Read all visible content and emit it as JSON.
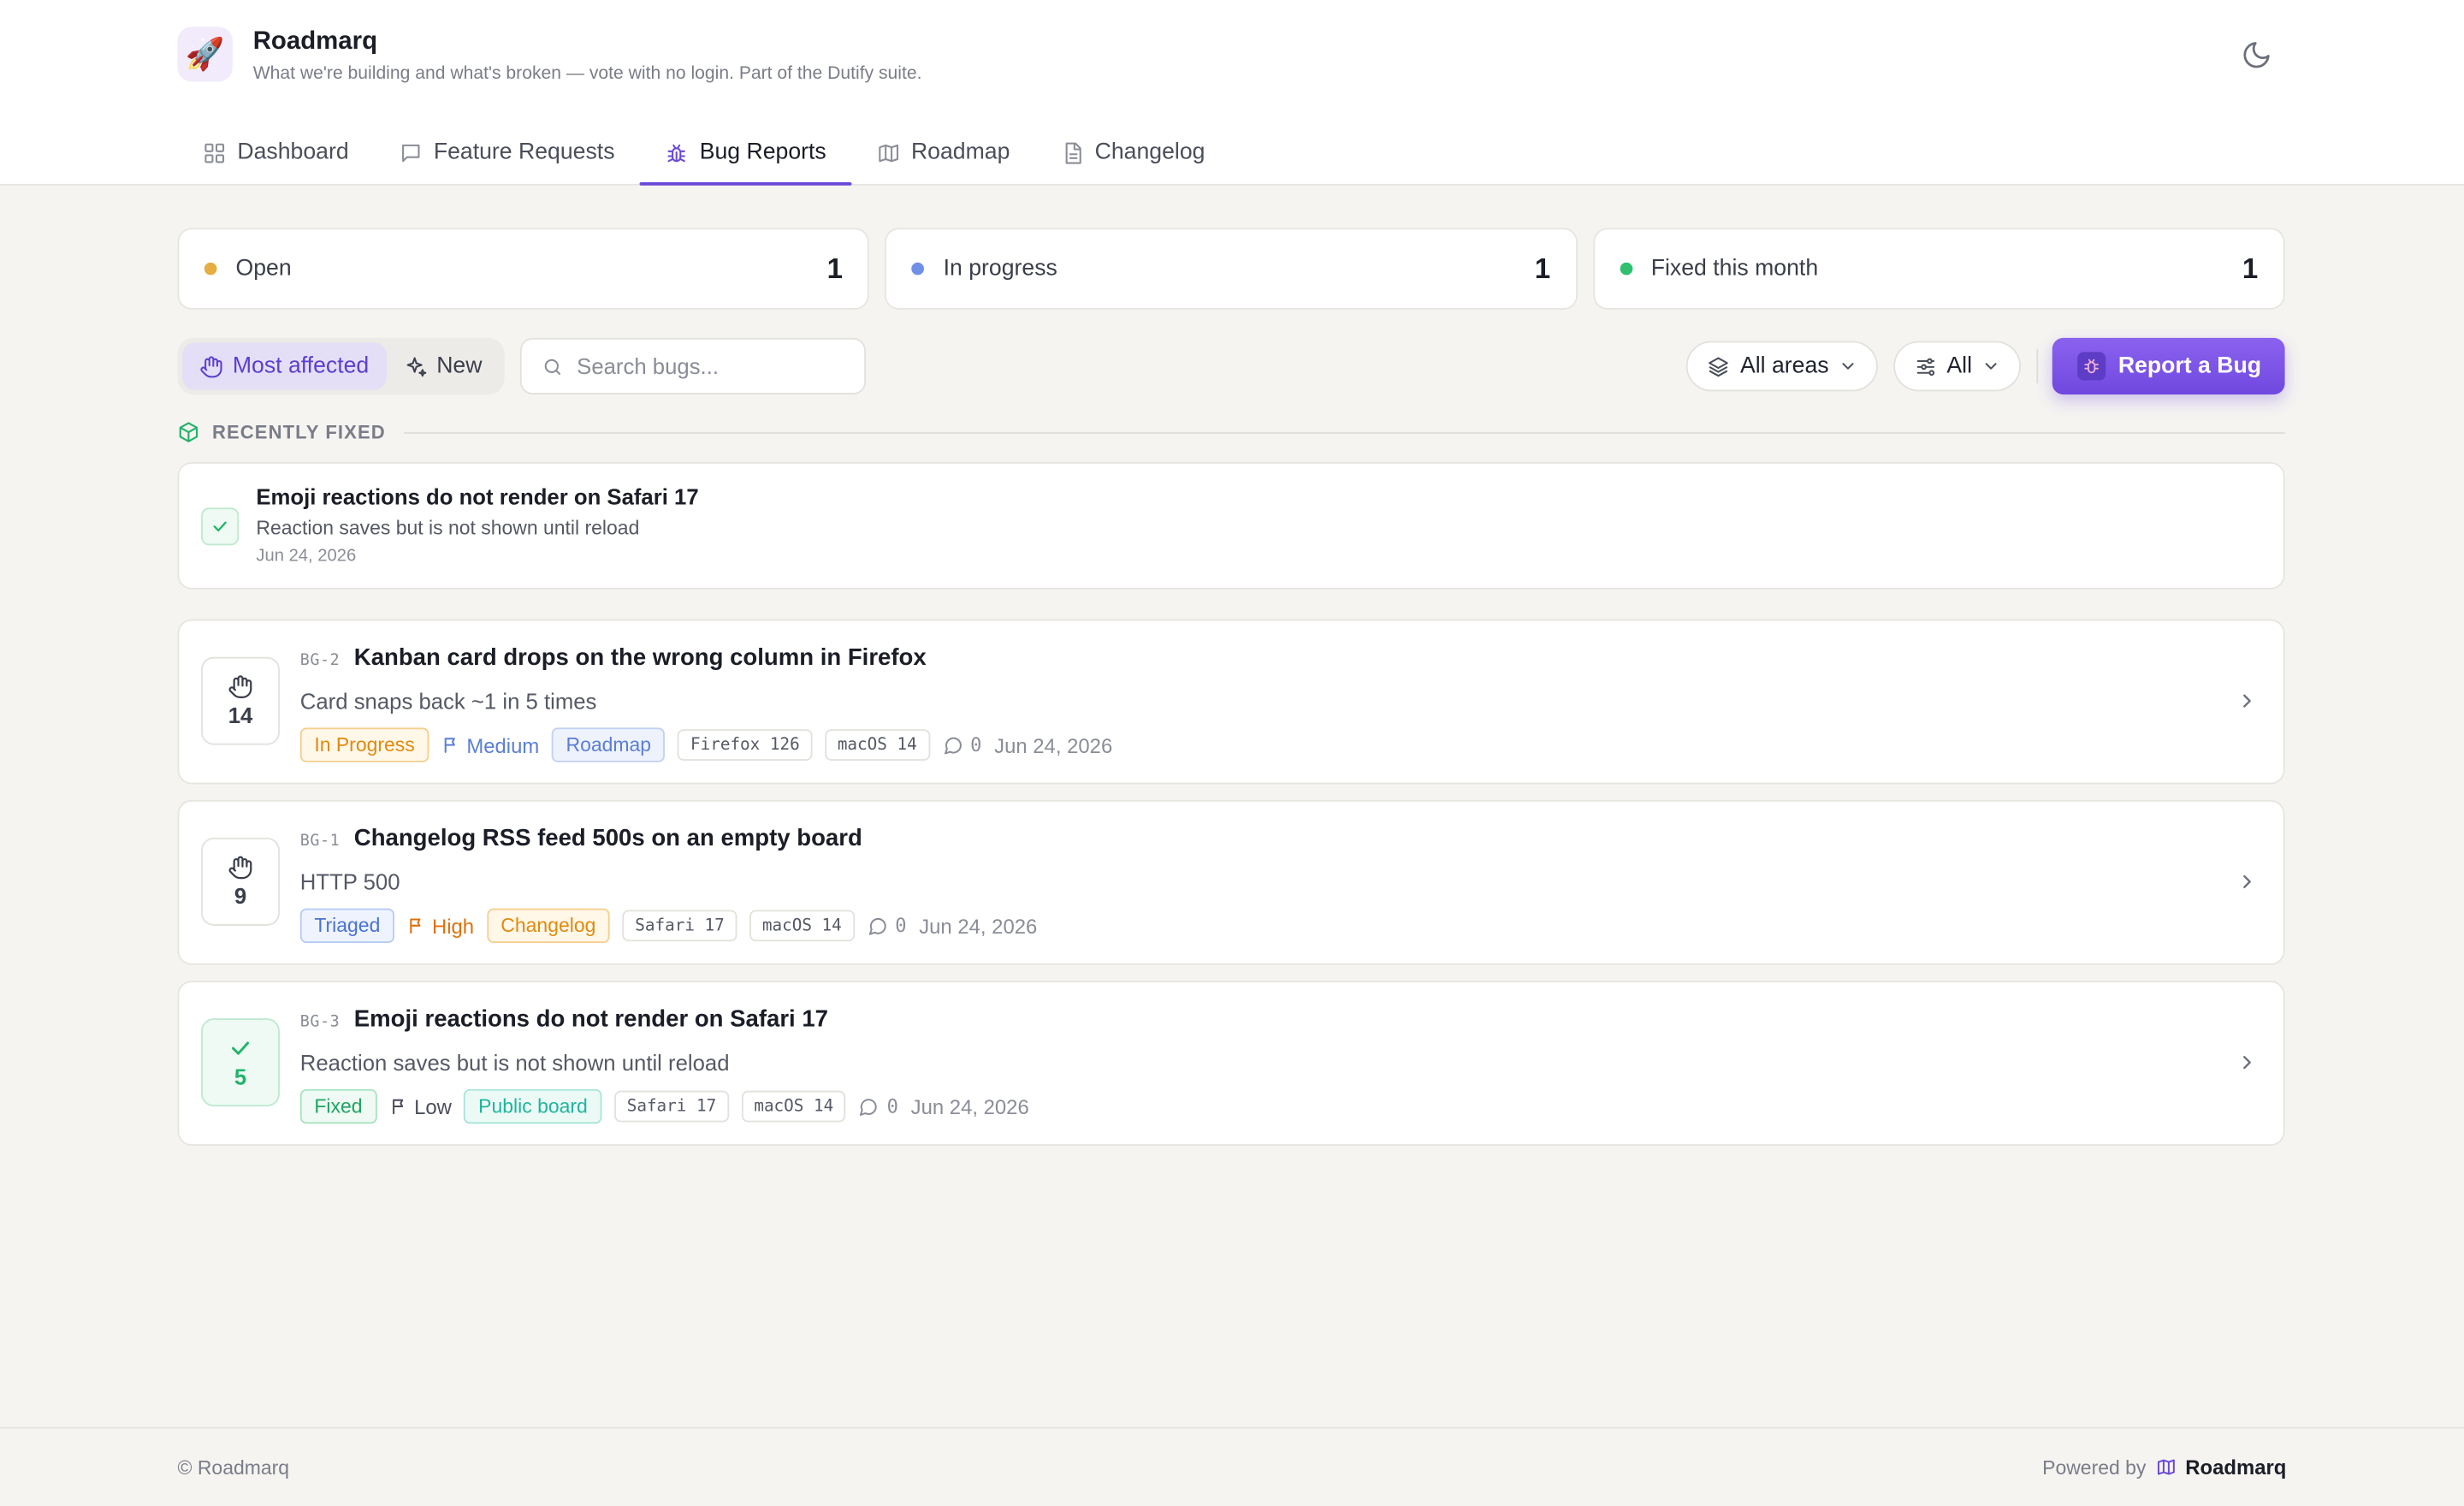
{
  "app": {
    "logo_emoji": "🚀",
    "title": "Roadmarq",
    "subtitle": "What we're building and what's broken — vote with no login. Part of the Dutify suite."
  },
  "tabs": [
    {
      "label": "Dashboard",
      "icon": "grid-icon",
      "active": false
    },
    {
      "label": "Feature Requests",
      "icon": "chat-icon",
      "active": false
    },
    {
      "label": "Bug Reports",
      "icon": "bug-icon",
      "active": true
    },
    {
      "label": "Roadmap",
      "icon": "map-icon",
      "active": false
    },
    {
      "label": "Changelog",
      "icon": "document-icon",
      "active": false
    }
  ],
  "stats": [
    {
      "label": "Open",
      "value": "1",
      "color": "#e4ae40"
    },
    {
      "label": "In progress",
      "value": "1",
      "color": "#6f8fe8"
    },
    {
      "label": "Fixed this month",
      "value": "1",
      "color": "#2fc070"
    }
  ],
  "toolbar": {
    "sort_most_affected": "Most affected",
    "sort_new": "New",
    "search_placeholder": "Search bugs...",
    "area_filter": "All areas",
    "status_filter": "All",
    "report_button": "Report a Bug"
  },
  "recently_fixed": {
    "heading": "RECENTLY FIXED",
    "title": "Emoji reactions do not render on Safari 17",
    "description": "Reaction saves but is not shown until reload",
    "date": "Jun 24, 2026"
  },
  "bugs": [
    {
      "id": "BG-2",
      "title": "Kanban card drops on the wrong column in Firefox",
      "description": "Card snaps back ~1 in 5 times",
      "votes": "14",
      "status": "In Progress",
      "priority": "Medium",
      "area": "Roadmap",
      "env": [
        "Firefox 126",
        "macOS 14"
      ],
      "comments": "0",
      "date": "Jun 24, 2026"
    },
    {
      "id": "BG-1",
      "title": "Changelog RSS feed 500s on an empty board",
      "description": "HTTP 500",
      "votes": "9",
      "status": "Triaged",
      "priority": "High",
      "area": "Changelog",
      "env": [
        "Safari 17",
        "macOS 14"
      ],
      "comments": "0",
      "date": "Jun 24, 2026"
    },
    {
      "id": "BG-3",
      "title": "Emoji reactions do not render on Safari 17",
      "description": "Reaction saves but is not shown until reload",
      "votes": "5",
      "status": "Fixed",
      "priority": "Low",
      "area": "Public board",
      "env": [
        "Safari 17",
        "macOS 14"
      ],
      "comments": "0",
      "date": "Jun 24, 2026"
    }
  ],
  "footer": {
    "copyright": "© Roadmarq",
    "powered_by": "Powered by",
    "powered_brand": "Roadmarq"
  }
}
